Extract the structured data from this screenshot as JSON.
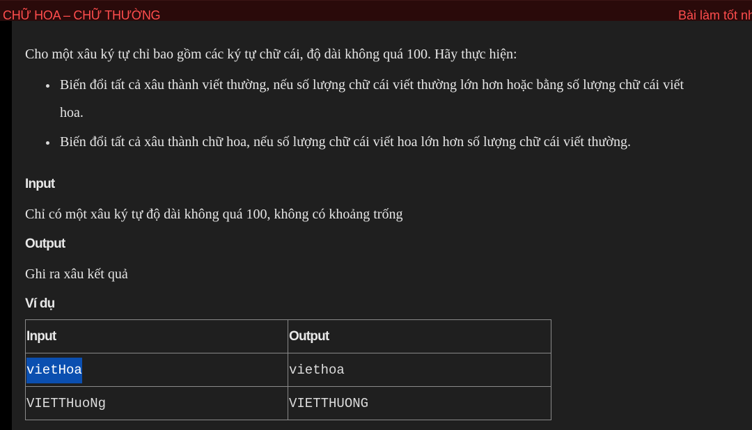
{
  "header": {
    "title": "CHỮ HOA – CHỮ THƯỜNG",
    "status": "Bài làm tốt nh"
  },
  "problem": {
    "intro": "Cho một xâu ký tự chỉ bao gồm các ký tự chữ cái, độ dài không quá 100. Hãy thực hiện:",
    "bullets": [
      {
        "line1": "Biến đổi tất cả xâu thành viết thường, nếu số lượng chữ cái viết thường lớn hơn hoặc bằng số lượng chữ cái viết",
        "line2": "hoa."
      },
      {
        "line1": "Biến đổi tất cả xâu thành chữ hoa, nếu số lượng chữ cái viết hoa lớn hơn số lượng chữ cái viết thường."
      }
    ],
    "input_heading": "Input",
    "input_text": "Chỉ có một xâu ký tự độ dài không quá 100, không có khoảng trống",
    "output_heading": "Output",
    "output_text": "Ghi ra xâu kết quả",
    "example_heading": "Ví dụ"
  },
  "examples": {
    "headers": [
      "Input",
      "Output"
    ],
    "rows": [
      [
        "vietHoa",
        "viethoa"
      ],
      [
        "VIETTHuoNg",
        "VIETTHUONG"
      ]
    ]
  },
  "colors": {
    "title_red": "#ff4d4d",
    "topbar_bg": "#2a0a0a",
    "content_bg": "#1f1f1f",
    "selection_blue": "#0b4fb0"
  }
}
